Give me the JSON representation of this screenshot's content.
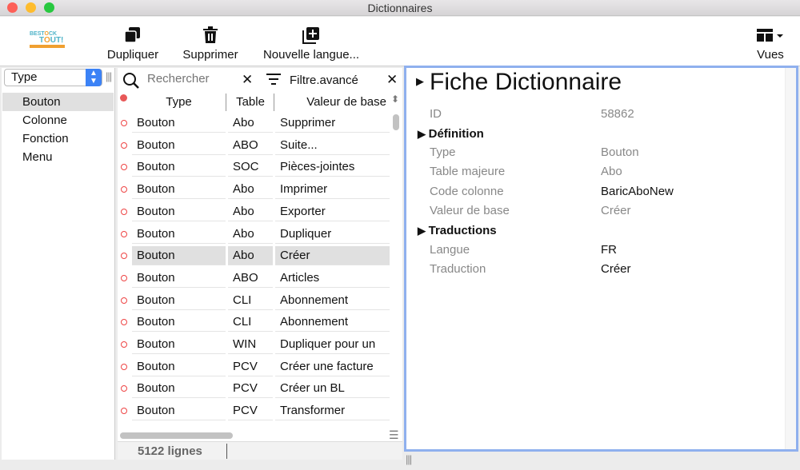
{
  "window": {
    "title": "Dictionnaires"
  },
  "toolbar": {
    "duplicate": "Dupliquer",
    "delete": "Supprimer",
    "new_language": "Nouvelle langue...",
    "views": "Vues",
    "logo_text": "BEST O CK TOUT!"
  },
  "left": {
    "select_value": "Type",
    "items": [
      "Bouton",
      "Colonne",
      "Fonction",
      "Menu"
    ],
    "selected": 0
  },
  "search": {
    "placeholder": "Rechercher",
    "filter_label": "Filtre.avancé"
  },
  "table": {
    "columns": [
      "Type",
      "Table",
      "Valeur de base"
    ],
    "rows": [
      [
        "Bouton",
        "Abo",
        "Supprimer"
      ],
      [
        "Bouton",
        "ABO",
        "Suite..."
      ],
      [
        "Bouton",
        "SOC",
        "Pièces-jointes"
      ],
      [
        "Bouton",
        "Abo",
        "Imprimer"
      ],
      [
        "Bouton",
        "Abo",
        "Exporter"
      ],
      [
        "Bouton",
        "Abo",
        "Dupliquer"
      ],
      [
        "Bouton",
        "Abo",
        "Créer"
      ],
      [
        "Bouton",
        "ABO",
        "Articles"
      ],
      [
        "Bouton",
        "CLI",
        "Abonnement"
      ],
      [
        "Bouton",
        "CLI",
        "Abonnement"
      ],
      [
        "Bouton",
        "WIN",
        "Dupliquer pour un"
      ],
      [
        "Bouton",
        "PCV",
        "Créer une facture"
      ],
      [
        "Bouton",
        "PCV",
        "Créer un BL"
      ],
      [
        "Bouton",
        "PCV",
        "Transformer"
      ]
    ],
    "selected_row": 6,
    "status": "5122 lignes"
  },
  "detail": {
    "title": "Fiche Dictionnaire",
    "id_label": "ID",
    "id_value": "58862",
    "definition": "Définition",
    "def_fields": [
      {
        "label": "Type",
        "value": "Bouton",
        "muted": true
      },
      {
        "label": "Table majeure",
        "value": "Abo",
        "muted": true
      },
      {
        "label": "Code colonne",
        "value": "BaricAboNew",
        "muted": false
      },
      {
        "label": "Valeur de base",
        "value": "Créer",
        "muted": true
      }
    ],
    "translations": "Traductions",
    "tr_fields": [
      {
        "label": "Langue",
        "value": "FR"
      },
      {
        "label": "Traduction",
        "value": "Créer"
      }
    ]
  },
  "colors": {
    "accent": "#3b82f6",
    "focus_border": "#8fb0ee",
    "marker": "#e44444"
  }
}
